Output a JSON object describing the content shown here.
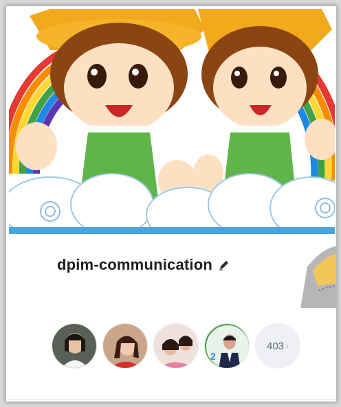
{
  "group": {
    "name": "dpim-communication",
    "member_count": "403",
    "chevron": "›"
  },
  "icons": {
    "edit": "pencil-icon",
    "chevron": "chevron-right-icon"
  },
  "colors": {
    "title": "#1c1e21",
    "pill_bg": "#eef0f3",
    "pill_text": "#5f6b7a",
    "hat": "#f2a91c",
    "shirt_green": "#5fb54a",
    "hair": "#8b4513"
  }
}
